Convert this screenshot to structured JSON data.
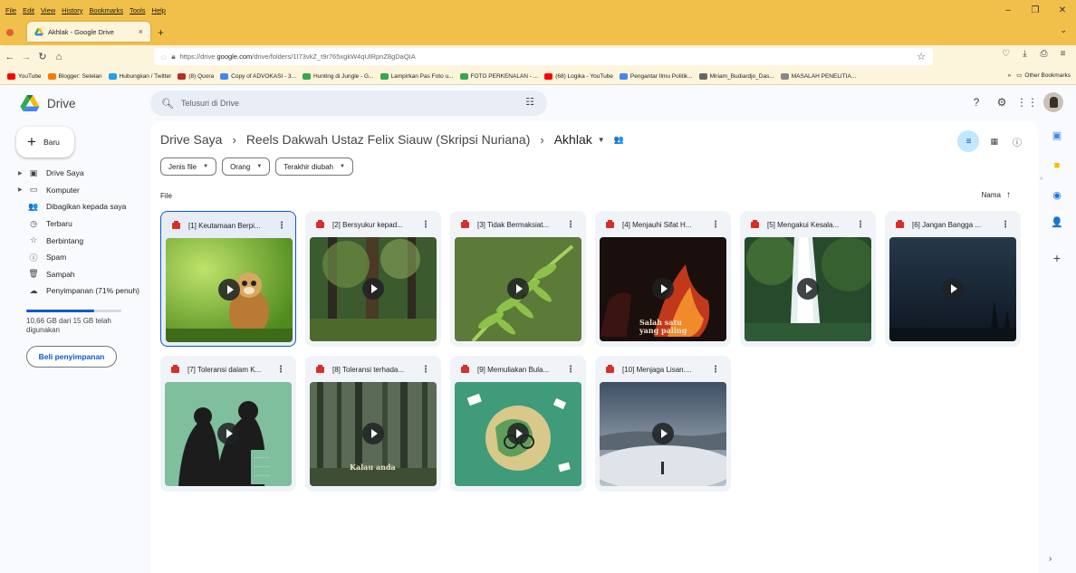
{
  "browser": {
    "menu": [
      "File",
      "Edit",
      "View",
      "History",
      "Bookmarks",
      "Tools",
      "Help"
    ],
    "tab_title": "Akhlak - Google Drive",
    "url_prefix": "https://drive.",
    "url_domain": "google.com",
    "url_suffix": "/drive/folders/1I73vkZ_t9r765xgkW4qUlRpnZ8gDaQIA",
    "bookmarks": [
      {
        "label": "YouTube",
        "color": "#ff0000"
      },
      {
        "label": "Blogger: Setelan",
        "color": "#f57c00"
      },
      {
        "label": "Hubungkan / Twitter",
        "color": "#1da1f2"
      },
      {
        "label": "(8) Quora",
        "color": "#b92b27"
      },
      {
        "label": "Copy of ADVOKASI - 3...",
        "color": "#4285f4"
      },
      {
        "label": "Hunting di Jungle - G...",
        "color": "#34a853"
      },
      {
        "label": "Lampirkan Pas Foto u...",
        "color": "#34a853"
      },
      {
        "label": "FOTO PERKENALAN - ...",
        "color": "#34a853"
      },
      {
        "label": "(68) Logika - YouTube",
        "color": "#ff0000"
      },
      {
        "label": "Pengantar Ilmu Politik...",
        "color": "#4285f4"
      },
      {
        "label": "Miriam_Budiardjo_Das...",
        "color": "#666666"
      },
      {
        "label": "MASALAH PENELITIA...",
        "color": "#888888"
      }
    ],
    "other_bookmarks": "Other Bookmarks"
  },
  "drive": {
    "app_name": "Drive",
    "search_placeholder": "Telusuri di Drive",
    "new_button": "Baru",
    "nav": [
      {
        "label": "Drive Saya",
        "icon": "drive-icon",
        "glyph": "▣",
        "caret": true
      },
      {
        "label": "Komputer",
        "icon": "computer-icon",
        "glyph": "▭",
        "caret": true
      },
      {
        "label": "Dibagikan kepada saya",
        "icon": "shared-icon",
        "glyph": "👥",
        "caret": false
      },
      {
        "label": "Terbaru",
        "icon": "clock-icon",
        "glyph": "◷",
        "caret": false
      },
      {
        "label": "Berbintang",
        "icon": "star-icon",
        "glyph": "☆",
        "caret": false
      },
      {
        "label": "Spam",
        "icon": "spam-icon",
        "glyph": "ⓘ",
        "caret": false
      },
      {
        "label": "Sampah",
        "icon": "trash-icon",
        "glyph": "🗑",
        "caret": false
      },
      {
        "label": "Penyimpanan (71% penuh)",
        "icon": "cloud-icon",
        "glyph": "☁",
        "caret": false
      }
    ],
    "storage_fraction": 0.71,
    "storage_text": "10,66 GB dari 15 GB telah digunakan",
    "buy_storage": "Beli penyimpanan",
    "breadcrumb": [
      "Drive Saya",
      "Reels Dakwah Ustaz Felix Siauw (Skripsi Nuriana)"
    ],
    "current_folder": "Akhlak",
    "filters": [
      "Jenis file",
      "Orang",
      "Terakhir diubah"
    ],
    "section_label": "File",
    "sort_label": "Nama",
    "files": [
      {
        "title": "[1] Keutamaan Berpi...",
        "theme": "monkey",
        "caption": ""
      },
      {
        "title": "[2] Bersyukur kepad...",
        "theme": "forest",
        "caption": ""
      },
      {
        "title": "[3] Tidak Bermaksiat...",
        "theme": "fern",
        "caption": ""
      },
      {
        "title": "[4] Menjauhi Sifat H...",
        "theme": "fire",
        "caption": "Salah satu\nyang paling"
      },
      {
        "title": "[5] Mengakui Kesala...",
        "theme": "waterfall",
        "caption": ""
      },
      {
        "title": "[6] Jangan Bangga ...",
        "theme": "night",
        "caption": ""
      },
      {
        "title": "[7] Toleransi dalam K...",
        "theme": "illustration",
        "caption": ""
      },
      {
        "title": "[8] Toleransi terhada...",
        "theme": "pines",
        "caption": "Kalau anda"
      },
      {
        "title": "[9] Memuliakan Bula...",
        "theme": "earth",
        "caption": ""
      },
      {
        "title": "[10] Menjaga Lisan....",
        "theme": "clouds",
        "caption": ""
      }
    ]
  }
}
